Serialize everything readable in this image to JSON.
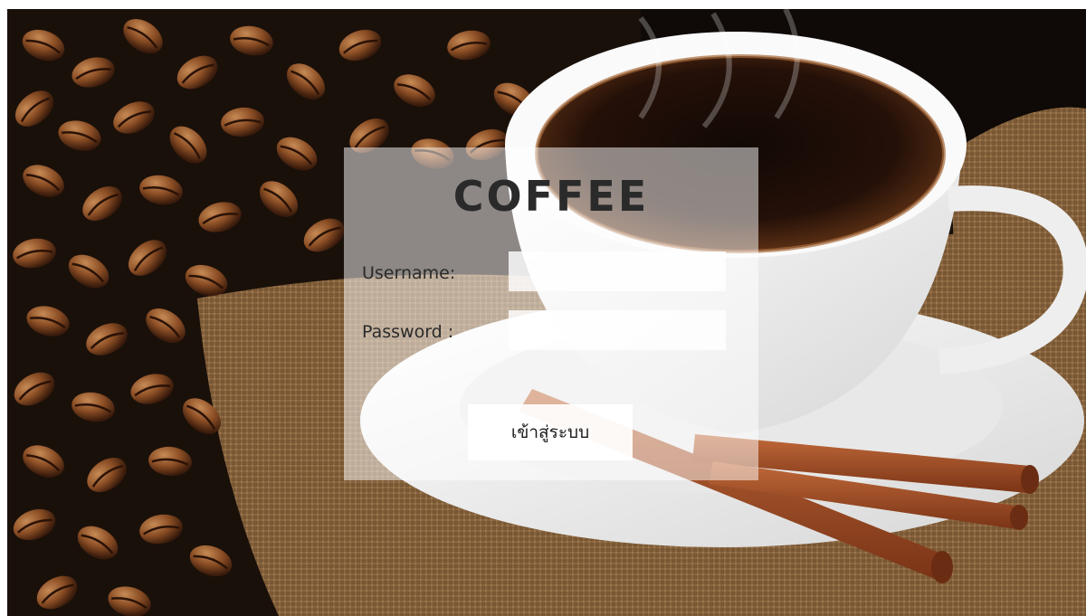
{
  "login": {
    "title": "COFFEE",
    "username_label": "Username:",
    "password_label": "Password :",
    "username_value": "",
    "password_value": "",
    "submit_label": "เข้าสู่ระบบ"
  },
  "background": {
    "image": "coffee-cup-with-beans-and-cinnamon-photo"
  },
  "colors": {
    "title": "#2a2a2a",
    "panel": "rgba(255,255,255,0.5)",
    "text": "#2a2a2a"
  }
}
